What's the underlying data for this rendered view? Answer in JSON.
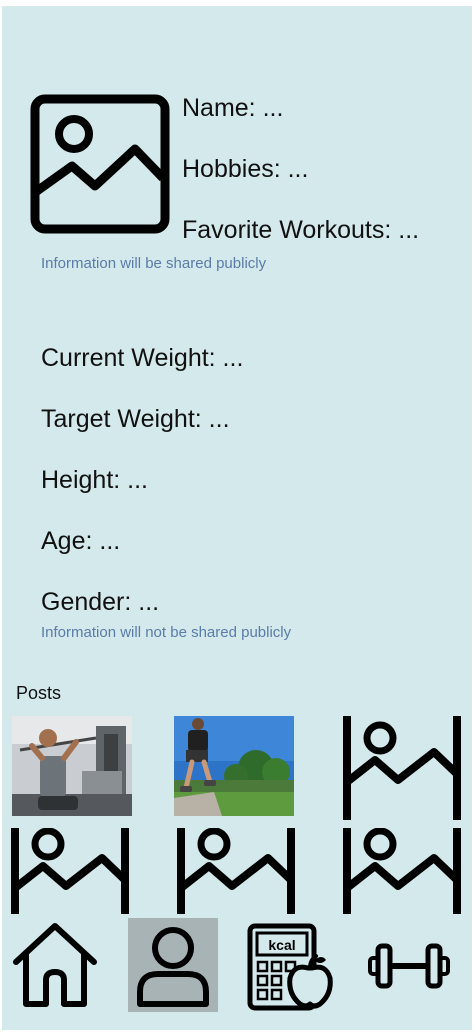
{
  "profile": {
    "name": "Name: ...",
    "hobbies": "Hobbies: ...",
    "favorite_workouts": "Favorite Workouts: ...",
    "public_note": "Information will be shared publicly"
  },
  "stats": {
    "current_weight": "Current Weight: ...",
    "target_weight": "Target Weight: ...",
    "height": "Height: ...",
    "age": "Age: ...",
    "gender": "Gender: ...",
    "private_note": "Information will not be shared publicly"
  },
  "posts": {
    "heading": "Posts",
    "items": [
      {
        "kind": "photo",
        "subject": "man doing lat pulldown at gym"
      },
      {
        "kind": "photo",
        "subject": "runner on park path"
      },
      {
        "kind": "placeholder",
        "icon": "image-placeholder-icon"
      },
      {
        "kind": "placeholder",
        "icon": "image-placeholder-icon"
      },
      {
        "kind": "placeholder",
        "icon": "image-placeholder-icon"
      },
      {
        "kind": "placeholder",
        "icon": "image-placeholder-icon"
      }
    ]
  },
  "nav": {
    "items": [
      {
        "icon": "home-icon",
        "active": false
      },
      {
        "icon": "profile-icon",
        "active": true
      },
      {
        "icon": "calorie-calculator-icon",
        "label": "kcal",
        "active": false
      },
      {
        "icon": "dumbbell-icon",
        "active": false
      }
    ]
  },
  "colors": {
    "background": "#d4e9ec",
    "text": "#111111",
    "note": "#5b7ba8",
    "active_nav": "#a8b3b5"
  }
}
